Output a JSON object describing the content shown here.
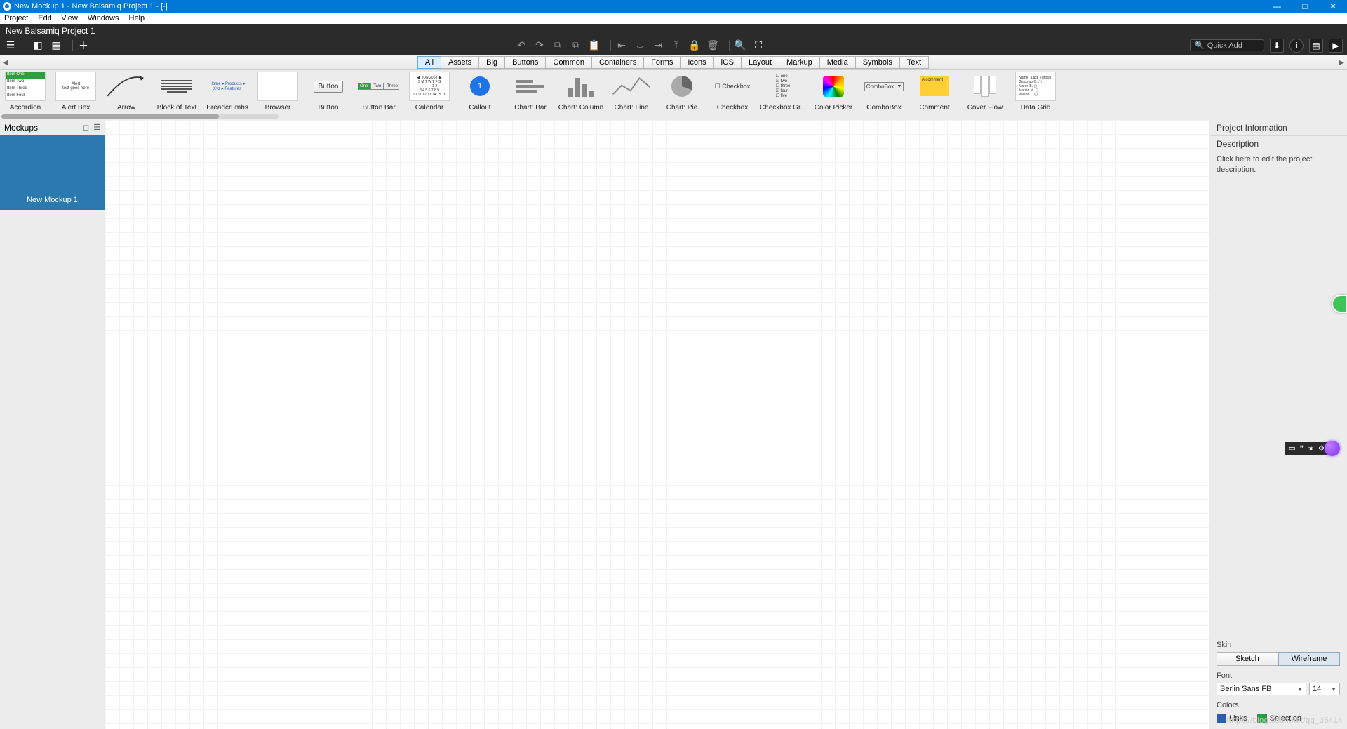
{
  "window": {
    "title": "New Mockup 1 - New Balsamiq Project 1 - [-]",
    "buttons": {
      "min": "—",
      "max": "□",
      "close": "✕"
    }
  },
  "menubar": [
    "Project",
    "Edit",
    "View",
    "Windows",
    "Help"
  ],
  "project": {
    "name": "New Balsamiq Project 1"
  },
  "quickadd": {
    "placeholder": "Quick Add"
  },
  "categories": [
    "All",
    "Assets",
    "Big",
    "Buttons",
    "Common",
    "Containers",
    "Forms",
    "Icons",
    "iOS",
    "Layout",
    "Markup",
    "Media",
    "Symbols",
    "Text"
  ],
  "categories_selected": "All",
  "library": [
    "Accordion",
    "Alert Box",
    "Arrow",
    "Block of Text",
    "Breadcrumbs",
    "Browser",
    "Button",
    "Button Bar",
    "Calendar",
    "Callout",
    "Chart: Bar",
    "Chart: Column",
    "Chart: Line",
    "Chart: Pie",
    "Checkbox",
    "Checkbox Gr...",
    "Color Picker",
    "ComboBox",
    "Comment",
    "Cover Flow",
    "Data Grid"
  ],
  "mockups": {
    "title": "Mockups",
    "items": [
      "New Mockup 1"
    ]
  },
  "rpanel": {
    "project_info": "Project Information",
    "description_label": "Description",
    "description_placeholder": "Click here to edit the project description.",
    "skin_label": "Skin",
    "skin_options": [
      "Sketch",
      "Wireframe"
    ],
    "skin_selected": "Wireframe",
    "font_label": "Font",
    "font_family": "Berlin Sans FB",
    "font_size": "14",
    "colors_label": "Colors",
    "colors": {
      "links": "Links",
      "selection": "Selection"
    }
  },
  "thumb_labels": {
    "button": "Button",
    "callout": "1",
    "checkbox": "☐ Checkbox",
    "combobox": "ComboBox",
    "comment": "A comment"
  },
  "watermark": "https://blog.csdn.net/qq_35414"
}
